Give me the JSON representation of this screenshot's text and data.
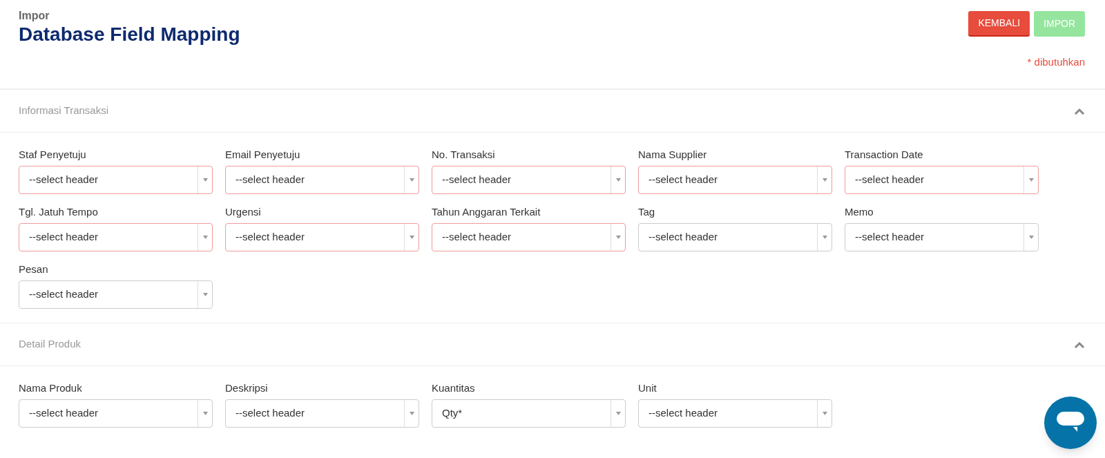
{
  "header": {
    "breadcrumb": "Impor",
    "title": "Database Field Mapping",
    "buttons": [
      {
        "label": "KEMBALI",
        "kind": "danger",
        "disabled": false
      },
      {
        "label": "IMPOR",
        "kind": "success",
        "disabled": true
      }
    ],
    "required_note": "* dibutuhkan"
  },
  "sections": [
    {
      "title": "Informasi Transaksi",
      "expanded": true,
      "fields": [
        {
          "label": "Staf Penyetuju",
          "value": "--select header",
          "required": true
        },
        {
          "label": "Email Penyetuju",
          "value": "--select header",
          "required": true
        },
        {
          "label": "No. Transaksi",
          "value": "--select header",
          "required": true
        },
        {
          "label": "Nama Supplier",
          "value": "--select header",
          "required": true
        },
        {
          "label": "Transaction Date",
          "value": "--select header",
          "required": true
        },
        {
          "label": "Tgl. Jatuh Tempo",
          "value": "--select header",
          "required": true
        },
        {
          "label": "Urgensi",
          "value": "--select header",
          "required": true
        },
        {
          "label": "Tahun Anggaran Terkait",
          "value": "--select header",
          "required": true
        },
        {
          "label": "Tag",
          "value": "--select header",
          "required": false
        },
        {
          "label": "Memo",
          "value": "--select header",
          "required": false
        },
        {
          "label": "Pesan",
          "value": "--select header",
          "required": false
        }
      ]
    },
    {
      "title": "Detail Produk",
      "expanded": true,
      "fields": [
        {
          "label": "Nama Produk",
          "value": "--select header",
          "required": false
        },
        {
          "label": "Deskripsi",
          "value": "--select header",
          "required": false
        },
        {
          "label": "Kuantitas",
          "value": "Qty*",
          "required": false
        },
        {
          "label": "Unit",
          "value": "--select header",
          "required": false
        }
      ]
    }
  ]
}
